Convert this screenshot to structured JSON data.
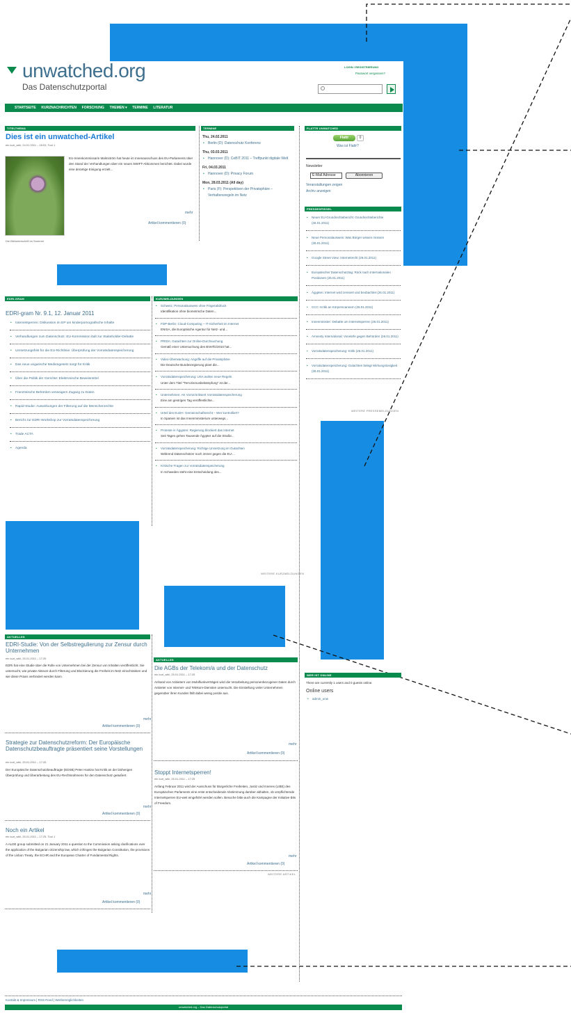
{
  "header": {
    "logo_main": "unwatched.org",
    "logo_sub": "Das Datenschutzportal",
    "login_link": "LOGIN / REGISTRIERUNG",
    "password_link": "Passwort vergessen?"
  },
  "nav": {
    "items": [
      "STARTSEITE",
      "KURZNACHRICHTEN",
      "FORSCHUNG",
      "THEMEN ▾",
      "TERMINE",
      "LITERATUR"
    ]
  },
  "feature": {
    "section": "Titelthema",
    "title": "Dies ist ein unwatched-Artikel",
    "meta": "ein kurt_wiki, 24.01.2011 – 18:03, Tool 1",
    "body": "EU-Innenkommissarin Malmström hat heute im Innenausschuss des EU-Parlaments über den Stand der Verhandlungen über ein neues SWIFT-Abkommen berichtet. Dabei wurde eine derartige Einigung erzielt...",
    "caption": "Die Bildunterschrift im Sommer",
    "more": "mehr",
    "comments": "Artikel kommentieren (0)"
  },
  "termine": {
    "section": "Termine",
    "days": [
      {
        "date": "Thu, 24.02.2011",
        "items": [
          "Berlin (D): Datenschutz Konferenz"
        ]
      },
      {
        "date": "Thu, 03.03.2011",
        "items": [
          "Hannover (D): CeBIT 2011 – Treffpunkt digitale Welt"
        ]
      },
      {
        "date": "Fri, 04.03.2011",
        "items": [
          "Hannover (D): Privacy Forum"
        ]
      },
      {
        "date": "Mon, 28.03.2011 (All day)",
        "items": [
          "Paris (F): Perspektiven der Privatsphäre – Verhaltensregeln im Netz"
        ]
      }
    ]
  },
  "right_top": {
    "section": "Flattr unwatched",
    "flattr_label": "Flattr",
    "flattr_count": "0",
    "flattr_question": "Was ist Flattr?",
    "newsletter_label": "Newsletter",
    "email_placeholder": "E-Mail Adresse",
    "subscribe_button": "Abonnieren",
    "links": [
      "Veranstaltungen zeigen",
      "Archiv anzeigen"
    ]
  },
  "news_right": {
    "section": "Pressespiegel",
    "items": [
      "Neuer EU-Grundrechtebericht: Grundrechteberichte (26.01.2011)",
      "Neue Personalausweis: Was Bürger wissen müssen (26.01.2011)",
      "Google Street View: Internetrecht (26.01.2011)",
      "Europäischer Datenschutztag: Rück nach Internationalen Positionen (26.01.2011)",
      "Ägypten: Internet wird zensiert und beobachtet (26.01.2011)",
      "CCC: Kritik an Körperscannern (26.01.2011)",
      "Innenminister: Debatte um Internetsperren (26.01.2011)",
      "Amnesty International: Vorwürfe gegen Behörden (26.01.2011)",
      "Vorratsdatenspeicherung: Kritik (26.01.2011)",
      "Vorratsdatenspeicherung: Gutachten belegt Wirkungslosigkeit (26.01.2011)"
    ],
    "more": "weitere Pressemeldungen"
  },
  "edri": {
    "section": "EDRI-gram",
    "title": "EDRI-gram Nr. 9.1, 12. Januar 2011",
    "items": [
      "Internetsperren: Diskussion im EP um kinderpornografische Inhalte",
      "Verhandlungen zum Datenschutz: EU-Kommission lädt zur Stakeholder-Debatte",
      "Umsetzungsfrist für die EU-Richtlinie: Überprüfung der Vorratsdatenspeicherung",
      "Das neue ungarische Mediengesetz sorgt für Kritik",
      "Über die Politik der Gerichte: Elektronische Beweismittel",
      "Französische Behörden verweigern Zugang zu Daten",
      "Rapid-Studie: Auswirkungen der Filterung auf die Menschenrechte",
      "Bericht zur EDRI Workshop zur Vorratsdatenspeicherung",
      "Trade ACTA",
      "Agenda"
    ]
  },
  "kurz": {
    "section": "Kurzmeldungen",
    "items": [
      {
        "title": "Schweiz: Personalausweis ohne Fingerabdruck",
        "teaser": "Identifikation ohne biometrische Daten..."
      },
      {
        "title": "FDP-Berlin: Cloud-Computing – IT-Sicherheit im Internet",
        "teaser": "ENISA, die Europäische Agentur für Netz- und..."
      },
      {
        "title": "PRIDA: Gutachten zur Online-Durchsuchung",
        "teaser": "Gemäß einer Untersuchung des BVerfG/2010 hat..."
      },
      {
        "title": "Video-Überwachung: Angriffe auf die Privatsphäre",
        "teaser": "Die Deutsche Bundesregierung plant die..."
      },
      {
        "title": "Vorratsdatenspeicherung: USA wollen neue Regeln",
        "teaser": "Unter dem Titel \"Terrorismusbekämpfung\" ist der..."
      },
      {
        "title": "Unternehmen: AK Vorrat kritisiert Vorratsdatenspeicherung",
        "teaser": "Eine am gestrigen Tag veröffentlichte..."
      },
      {
        "title": "Urteil des EuGH: Gemeinschaftsrecht – Wer kontrolliert?",
        "teaser": "In Spanien ist das Innenministerium unterwegs..."
      },
      {
        "title": "Proteste in Ägypten: Regierung blockiert das Internet",
        "teaser": "Seit Tagen gehen Tausende Ägypter auf die Straße..."
      },
      {
        "title": "Vorratsdatenspeicherung: Richtige Umsetzung im Gutachten",
        "teaser": "Während Datenschützer noch immer gegen die EU-..."
      },
      {
        "title": "Kritische Fragen zur Vorratsdatenspeicherung",
        "teaser": "In Schweden steht eine Entscheidung des..."
      }
    ],
    "more": "weitere Kurzmeldungen"
  },
  "articles_left": [
    {
      "section": "Aktuelles",
      "title": "EDRI-Studie: Von der Selbstregulierung zur Zensur durch Unternehmen",
      "meta": "ein kurt_wiki, 25.01.2011 – 17:25",
      "body": "EDRi hat eine Studie über die Rolle von Unternehmen bei der Zensur von Inhalten veröffentlicht. Sie untersucht, wie private Akteure durch Filterung und Blockierung die Freiheit im Netz einschränken und wie diese Praxis verhindert werden kann.",
      "more": "mehr",
      "comments": "Artikel kommentieren (0)"
    },
    {
      "title": "Strategie zur Datenschutzreform: Der Europäische Datenschutzbeauftragte präsentiert seine Vorstellungen",
      "meta": "ein kurt_wiki, 25.01.2011 – 17:25",
      "body": "Der Europäische Datenschutzbeauftragte (EDSB) Peter Hustinx hat Kritik an der bisherigen Überprüfung und Überarbeitung des EU-Rechtsrahmens für den Datenschutz geäußert.",
      "more": "mehr",
      "comments": "Artikel kommentieren (0)"
    },
    {
      "title": "Noch ein Artikel",
      "meta": "ein kurt_wiki, 25.01.2011 – 17:25, Tool 1",
      "body": "A ALDE group submitted on 21 January 2011 a question to the Commission asking clarifications over the application of the Bulgarian citizenship law, which infringes the Bulgarian Constitution, the provisions of the Lisbon Treaty, the ECHR and the European Charter of Fundamental Rights.",
      "more": "mehr",
      "comments": "Artikel kommentieren (0)"
    }
  ],
  "articles_mid": [
    {
      "section": "Aktuelles",
      "title": "Die AGBs der Telekom/a und der Datenschutz",
      "meta": "ein kurt_wiki, 25.01.2011 – 17:25",
      "body": "Anhand von Anbietern von Mobilfunkverträgen wird die Verarbeitung personenbezogener Daten durch Anbieter von Internet- und Telekom-Diensten untersucht. Die Einstellung vieler Unternehmen gegenüber ihren Kunden fällt dabei wenig positiv aus.",
      "more": "mehr",
      "comments": "Artikel kommentieren (0)"
    },
    {
      "title": "Stoppt Internetsperren!",
      "meta": "ein kurt_wiki, 25.01.2011 – 17:25",
      "body": "Anfang Februar 2011 wird der Ausschuss für Bürgerliche Freiheiten, Justiz und Inneres (LIBE) des Europäischen Parlaments eine erste entscheidende Abstimmung darüber abhalten, ob verpflichtende Internetsperren EU-weit eingeführt werden sollen. Besuche bitte auch die Kampagne der Initiative Bits of Freedom.",
      "more": "mehr",
      "comments": "Artikel kommentieren (0)"
    }
  ],
  "articles_more": "weitere Artikel",
  "online": {
    "section": "Wer ist online",
    "text": "There are currently 1 users and 0 guests online.",
    "title": "Online users",
    "users": [
      "admin_unw"
    ]
  },
  "footer": {
    "links": "Kontakt & Impressum | RSS-Feed | Werbemöglichkeiten",
    "bar": "unwatched.org – Das Datenschutzportal"
  }
}
